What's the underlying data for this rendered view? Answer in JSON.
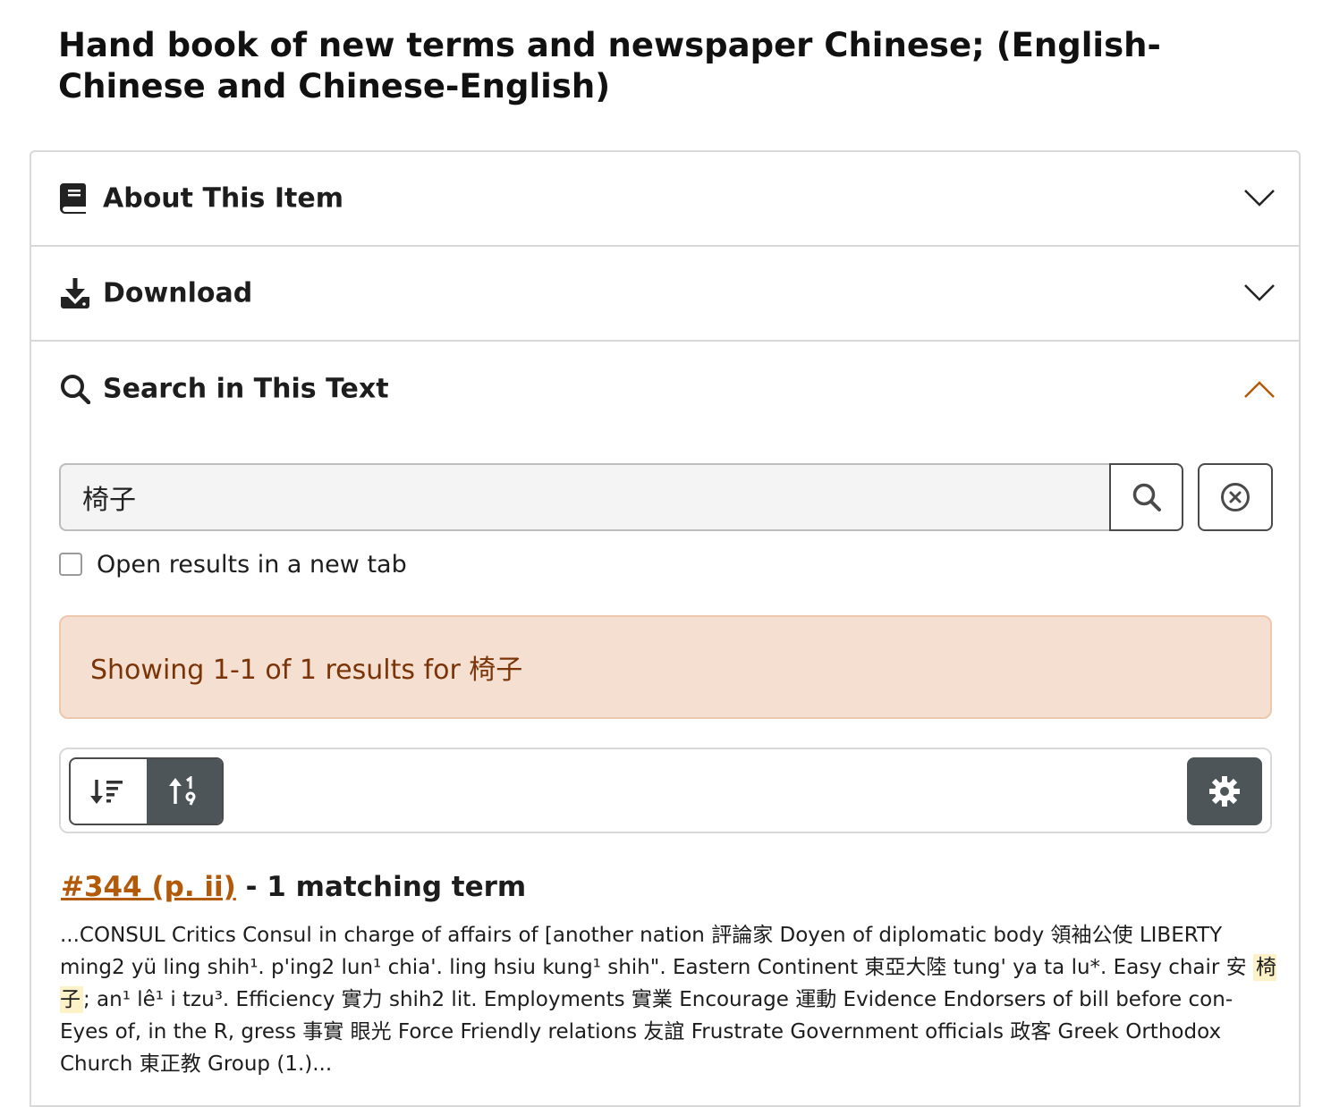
{
  "page_title": "Hand book of new terms and newspaper Chinese; (English-Chinese and Chinese-English)",
  "sections": {
    "about": {
      "label": "About This Item",
      "icon": "book-icon",
      "state": "collapsed"
    },
    "download": {
      "label": "Download",
      "icon": "download-icon",
      "state": "collapsed"
    },
    "search": {
      "label": "Search in This Text",
      "icon": "search-icon",
      "state": "expanded"
    }
  },
  "search": {
    "query": "椅子",
    "submit_icon": "search-icon",
    "clear_icon": "clear-circle-icon",
    "open_new_tab_label": "Open results in a new tab",
    "open_new_tab_checked": false,
    "results_summary": "Showing 1-1 of 1 results for 椅子"
  },
  "toolbar": {
    "sort_buttons": [
      {
        "icon": "sort-descending-icon",
        "active": false
      },
      {
        "icon": "sort-ascending-numeric-icon",
        "active": true
      }
    ],
    "settings_icon": "gear-icon"
  },
  "results": [
    {
      "link_text": "#344 (p. ii)",
      "match_text": " - 1 matching term",
      "snippet_before": "...CONSUL Critics Consul in charge of affairs of [another nation 評論家 Doyen of diplomatic body 領袖公使 LIBERTY ming2 yü ling shih¹. p'ing2 lun¹ chia'. ling hsiu kung¹ shih\". Eastern Continent 東亞大陸 tung' ya ta lu*. Easy chair 安 ",
      "snippet_highlight": "椅子",
      "snippet_after": "; an¹ lê¹ i tzu³. Efficiency 實力 shih2 lit. Employments 實業 Encourage 運動 Evidence Endorsers of bill before con- Eyes of, in the R, gress 事實 眼光 Force Friendly relations 友誼 Frustrate Government officials 政客 Greek Orthodox Church 東正教 Group (1.)..."
    }
  ],
  "colors": {
    "accent": "#b35a0a",
    "banner_bg": "#f4dfd0",
    "banner_text": "#7a3407",
    "dark_button": "#4e5558",
    "highlight": "#fdf1c8"
  }
}
